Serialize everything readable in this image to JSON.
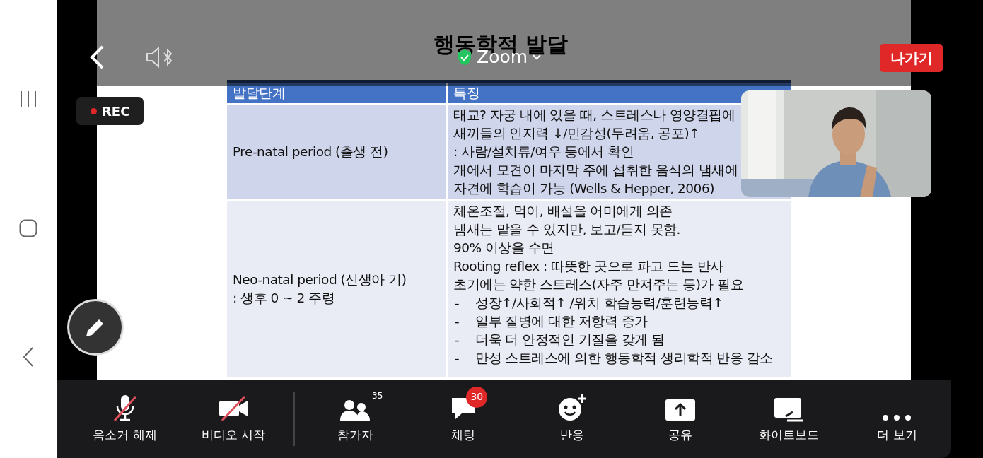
{
  "meeting_bar": {
    "app_name": "Zoom",
    "leave_button": "나가기"
  },
  "recording": {
    "label": "REC"
  },
  "slide": {
    "title": "행동학적 발달",
    "table": {
      "columns": [
        "발달단계",
        "특징"
      ],
      "rows": [
        {
          "stage": [
            "Pre-natal period (출생 전)"
          ],
          "features": [
            {
              "text": "태교? 자궁 내에 있을 때, 스트레스나 영양결핍에"
            },
            {
              "text": "새끼들의 인지력 ↓/민감성(두려움, 공포)↑"
            },
            {
              "text": ": 사람/설치류/여우 등에서 확인"
            },
            {
              "text": "개에서 모견이 마지막 주에 섭취한 음식의 냄새에"
            },
            {
              "text": "자견에 학습이 가능 (Wells & Hepper, 2006)"
            }
          ]
        },
        {
          "stage": [
            "Neo-natal period (신생아 기)",
            ": 생후 0 ~ 2 주령"
          ],
          "features": [
            {
              "text": "체온조절, 먹이, 배설을 어미에게 의존"
            },
            {
              "text": "냄새는 맡을 수 있지만, 보고/듣지 못함."
            },
            {
              "text": "90% 이상을 수면"
            },
            {
              "text": "Rooting reflex : 따뜻한 곳으로 파고 드는 반사"
            },
            {
              "text": "초기에는 약한 스트레스(자주 만져주는 등)가 필요"
            },
            {
              "marker": "-",
              "text": "성장↑/사회적↑ /위치 학습능력/훈련능력↑"
            },
            {
              "marker": "-",
              "text": "일부 질병에 대한 저항력 증가"
            },
            {
              "marker": "-",
              "text": "더욱 더 안정적인 기질을 갖게 됨"
            },
            {
              "marker": "-",
              "text": "만성 스트레스에 의한 행동학적 생리학적 반응 감소"
            }
          ]
        }
      ]
    }
  },
  "toolbar": [
    {
      "kind": "mic",
      "label": "음소거 해제"
    },
    {
      "kind": "video",
      "label": "비디오 시작"
    },
    {
      "kind": "participants",
      "label": "참가자",
      "badge": "35"
    },
    {
      "kind": "chat",
      "label": "채팅",
      "badge": "30"
    },
    {
      "kind": "reaction",
      "label": "반응"
    },
    {
      "kind": "share",
      "label": "공유"
    },
    {
      "kind": "whiteboard",
      "label": "화이트보드"
    },
    {
      "kind": "more",
      "label": "더 보기"
    }
  ]
}
